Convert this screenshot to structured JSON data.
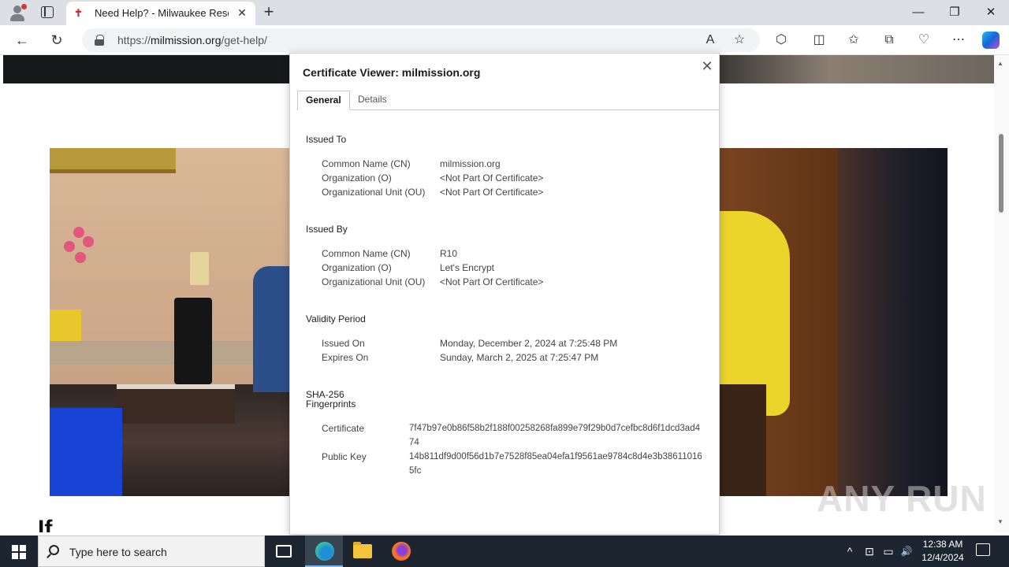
{
  "browser": {
    "tab_title": "Need Help? - Milwaukee Rescue",
    "tab_close": "✕",
    "new_tab": "+",
    "window_controls": {
      "minimize": "—",
      "restore": "❐",
      "close": "✕"
    },
    "url_prefix": "https://",
    "url_host": "milmission.org",
    "url_path": "/get-help/",
    "nav": {
      "back": "←",
      "refresh": "↻"
    },
    "tools": {
      "read_aloud": "A",
      "favorite": "☆",
      "extensions": "⬡",
      "split": "◫",
      "favorites": "✩",
      "collections": "⧉",
      "performance": "♡",
      "more": "⋯"
    }
  },
  "page": {
    "bottom_text": "If   _ _ _   _ _ _   _ _   _ _ _"
  },
  "certificate": {
    "title": "Certificate Viewer: milmission.org",
    "close": "✕",
    "tabs": {
      "general": "General",
      "details": "Details"
    },
    "issued_to": {
      "heading": "Issued To",
      "rows": [
        {
          "label": "Common Name (CN)",
          "value": "milmission.org"
        },
        {
          "label": "Organization (O)",
          "value": "<Not Part Of Certificate>"
        },
        {
          "label": "Organizational Unit (OU)",
          "value": "<Not Part Of Certificate>"
        }
      ]
    },
    "issued_by": {
      "heading": "Issued By",
      "rows": [
        {
          "label": "Common Name (CN)",
          "value": "R10"
        },
        {
          "label": "Organization (O)",
          "value": "Let's Encrypt"
        },
        {
          "label": "Organizational Unit (OU)",
          "value": "<Not Part Of Certificate>"
        }
      ]
    },
    "validity": {
      "heading": "Validity Period",
      "rows": [
        {
          "label": "Issued On",
          "value": "Monday, December 2, 2024 at 7:25:48 PM"
        },
        {
          "label": "Expires On",
          "value": "Sunday, March 2, 2025 at 7:25:47 PM"
        }
      ]
    },
    "fingerprints": {
      "heading_line1": "SHA-256",
      "heading_line2": "Fingerprints",
      "rows": [
        {
          "label": "Certificate",
          "value": "7f47b97e0b86f58b2f188f00258268fa899e79f29b0d7cefbc8d6f1dcd3ad474"
        },
        {
          "label": "Public Key",
          "value": "14b811df9d00f56d1b7e7528f85ea04efa1f9561ae9784c8d4e3b386110165fc"
        }
      ]
    }
  },
  "watermark": "ANY RUN",
  "taskbar": {
    "search_placeholder": "Type here to search",
    "time": "12:38 AM",
    "date": "12/4/2024",
    "tray": {
      "chevron": "^",
      "network": "⊡",
      "volume": "🔊"
    }
  }
}
